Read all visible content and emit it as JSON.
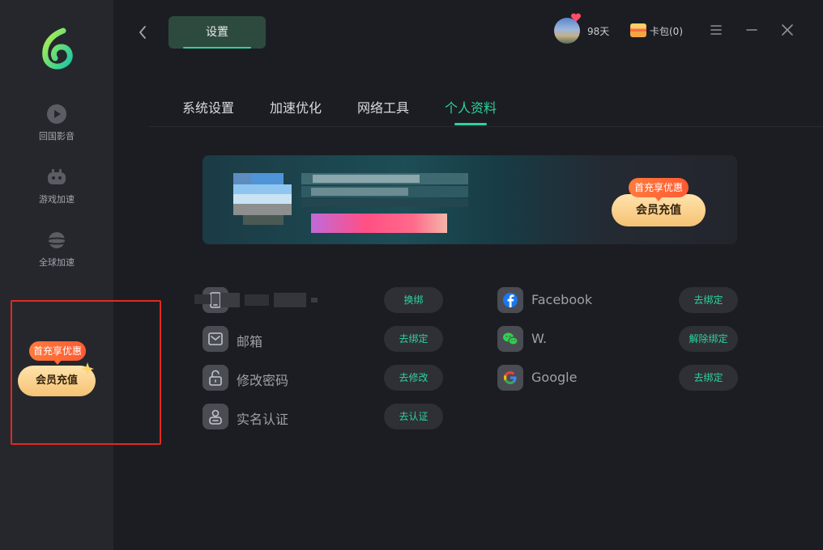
{
  "sidebar": {
    "items": [
      {
        "label": "回国影音",
        "icon": "play-icon"
      },
      {
        "label": "游戏加速",
        "icon": "gamepad-icon"
      },
      {
        "label": "全球加速",
        "icon": "planet-icon"
      }
    ],
    "promo": {
      "badge": "首充享优惠",
      "button": "会员充值"
    }
  },
  "header": {
    "tab_label": "设置",
    "vip_days": "98天",
    "wallet": "卡包(0)"
  },
  "tabs": [
    {
      "label": "系统设置",
      "active": false
    },
    {
      "label": "加速优化",
      "active": false
    },
    {
      "label": "网络工具",
      "active": false
    },
    {
      "label": "个人资料",
      "active": true
    }
  ],
  "banner": {
    "badge": "首充享优惠",
    "button": "会员充值"
  },
  "account_rows": [
    {
      "icon": "phone-icon",
      "label": "",
      "action": "换绑"
    },
    {
      "icon": "mail-icon",
      "label": "邮箱",
      "action": "去绑定"
    },
    {
      "icon": "unlock-icon",
      "label": "修改密码",
      "action": "去修改"
    },
    {
      "icon": "id-card-icon",
      "label": "实名认证",
      "action": "去认证"
    }
  ],
  "social_rows": [
    {
      "icon": "facebook-icon",
      "label": "Facebook",
      "action": "去绑定"
    },
    {
      "icon": "wechat-icon",
      "label": "W.",
      "action": "解除绑定"
    },
    {
      "icon": "google-icon",
      "label": "Google",
      "action": "去绑定"
    }
  ],
  "colors": {
    "accent": "#2ed29b",
    "background": "#1c1d22",
    "sidebar": "#26272d",
    "promo_orange": "#ff6a36",
    "promo_gold": "#f5c274",
    "highlight_border": "#e02a20"
  }
}
